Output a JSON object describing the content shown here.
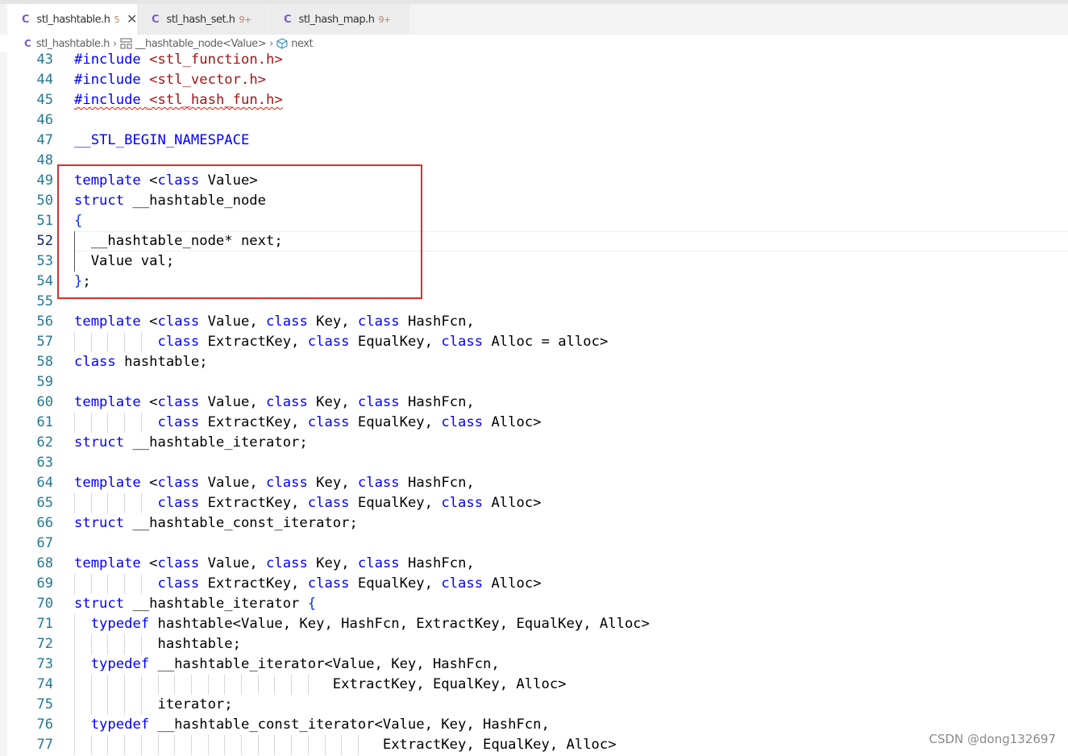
{
  "tabs": [
    {
      "label": "stl_hashtable.h",
      "badge": "5",
      "icon": "c-file-icon",
      "close": "✕"
    },
    {
      "label": "stl_hash_set.h",
      "badge": "9+",
      "icon": "c-file-icon"
    },
    {
      "label": "stl_hash_map.h",
      "badge": "9+",
      "icon": "c-file-icon"
    }
  ],
  "breadcrumb": {
    "file": "stl_hashtable.h",
    "struct": "__hashtable_node<Value>",
    "field": "next"
  },
  "colors": {
    "keyword": "#0000ff",
    "string": "#a31515",
    "line_number": "#237893",
    "highlight_border": "#e02b2b"
  },
  "code_lines": [
    {
      "n": "43",
      "html": "<span class='tk-kw'>#include</span> <span class='tk-str'>&lt;stl_function.h&gt;</span>"
    },
    {
      "n": "44",
      "html": "<span class='tk-kw'>#include</span> <span class='tk-str'>&lt;stl_vector.h&gt;</span>"
    },
    {
      "n": "45",
      "html": "<span class='squig'><span class='tk-kw'>#include</span> <span class='tk-str'>&lt;stl_hash_fun.h&gt;</span></span>"
    },
    {
      "n": "46",
      "html": ""
    },
    {
      "n": "47",
      "html": "<span class='tk-ns'>__STL_BEGIN_NAMESPACE</span>"
    },
    {
      "n": "48",
      "html": ""
    },
    {
      "n": "49",
      "html": "<span class='tk-kw'>template</span> &lt;<span class='tk-kw'>class</span> Value&gt;"
    },
    {
      "n": "50",
      "html": "<span class='tk-kw'>struct</span> __hashtable_node"
    },
    {
      "n": "51",
      "html": "<span class='tk-brace'>{</span>"
    },
    {
      "n": "52",
      "html": "  __hashtable_node* next;"
    },
    {
      "n": "53",
      "html": "  Value val;"
    },
    {
      "n": "54",
      "html": "<span class='tk-brace'>}</span>;"
    },
    {
      "n": "55",
      "html": ""
    },
    {
      "n": "56",
      "html": "<span class='tk-kw'>template</span> &lt;<span class='tk-kw'>class</span> Value, <span class='tk-kw'>class</span> Key, <span class='tk-kw'>class</span> HashFcn,"
    },
    {
      "n": "57",
      "html": "          <span class='tk-kw'>class</span> ExtractKey, <span class='tk-kw'>class</span> EqualKey, <span class='tk-kw'>class</span> Alloc = alloc&gt;"
    },
    {
      "n": "58",
      "html": "<span class='tk-kw'>class</span> hashtable;"
    },
    {
      "n": "59",
      "html": ""
    },
    {
      "n": "60",
      "html": "<span class='tk-kw'>template</span> &lt;<span class='tk-kw'>class</span> Value, <span class='tk-kw'>class</span> Key, <span class='tk-kw'>class</span> HashFcn,"
    },
    {
      "n": "61",
      "html": "          <span class='tk-kw'>class</span> ExtractKey, <span class='tk-kw'>class</span> EqualKey, <span class='tk-kw'>class</span> Alloc&gt;"
    },
    {
      "n": "62",
      "html": "<span class='tk-kw'>struct</span> __hashtable_iterator;"
    },
    {
      "n": "63",
      "html": ""
    },
    {
      "n": "64",
      "html": "<span class='tk-kw'>template</span> &lt;<span class='tk-kw'>class</span> Value, <span class='tk-kw'>class</span> Key, <span class='tk-kw'>class</span> HashFcn,"
    },
    {
      "n": "65",
      "html": "          <span class='tk-kw'>class</span> ExtractKey, <span class='tk-kw'>class</span> EqualKey, <span class='tk-kw'>class</span> Alloc&gt;"
    },
    {
      "n": "66",
      "html": "<span class='tk-kw'>struct</span> __hashtable_const_iterator;"
    },
    {
      "n": "67",
      "html": ""
    },
    {
      "n": "68",
      "html": "<span class='tk-kw'>template</span> &lt;<span class='tk-kw'>class</span> Value, <span class='tk-kw'>class</span> Key, <span class='tk-kw'>class</span> HashFcn,"
    },
    {
      "n": "69",
      "html": "          <span class='tk-kw'>class</span> ExtractKey, <span class='tk-kw'>class</span> EqualKey, <span class='tk-kw'>class</span> Alloc&gt;"
    },
    {
      "n": "70",
      "html": "<span class='tk-kw'>struct</span> __hashtable_iterator <span class='tk-brace'>{</span>"
    },
    {
      "n": "71",
      "html": "  <span class='tk-kw'>typedef</span> hashtable&lt;Value, Key, HashFcn, ExtractKey, EqualKey, Alloc&gt;"
    },
    {
      "n": "72",
      "html": "          hashtable;"
    },
    {
      "n": "73",
      "html": "  <span class='tk-kw'>typedef</span> __hashtable_iterator&lt;Value, Key, HashFcn,"
    },
    {
      "n": "74",
      "html": "                               ExtractKey, EqualKey, Alloc&gt;"
    },
    {
      "n": "75",
      "html": "          iterator;"
    },
    {
      "n": "76",
      "html": "  <span class='tk-kw'>typedef</span> __hashtable_const_iterator&lt;Value, Key, HashFcn,"
    },
    {
      "n": "77",
      "html": "                                     ExtractKey, EqualKey, Alloc&gt;"
    }
  ],
  "watermark": "CSDN @dong132697"
}
